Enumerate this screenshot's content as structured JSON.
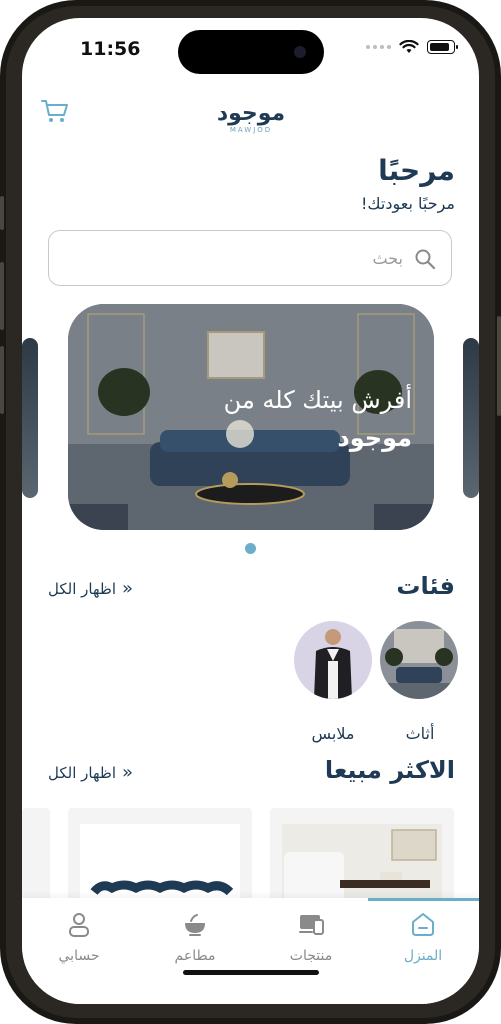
{
  "status_bar": {
    "time": "11:56"
  },
  "header": {
    "cart_icon": "cart-icon",
    "logo_ar": "موجود",
    "logo_en": "MAWJOD"
  },
  "welcome": {
    "title": "مرحبًا",
    "subtitle": "مرحبًا بعودتك!"
  },
  "search": {
    "placeholder": "بحث"
  },
  "banner": {
    "line1": "أفرش بيتك كله من",
    "line2": "موجود"
  },
  "categories_section": {
    "title": "فئات",
    "see_all": "اظهار الكل",
    "items": [
      {
        "label": "أثاث"
      },
      {
        "label": "ملابس"
      }
    ]
  },
  "bestsellers_section": {
    "title": "الاكثر مبيعا",
    "see_all": "اظهار الكل"
  },
  "tabbar": {
    "items": [
      {
        "label": "المنزل",
        "icon": "home-icon",
        "active": true
      },
      {
        "label": "منتجات",
        "icon": "devices-icon",
        "active": false
      },
      {
        "label": "مطاعم",
        "icon": "bowl-icon",
        "active": false
      },
      {
        "label": "حسابي",
        "icon": "user-icon",
        "active": false
      }
    ]
  },
  "colors": {
    "primary": "#1f3a55",
    "accent": "#6aaec9"
  }
}
